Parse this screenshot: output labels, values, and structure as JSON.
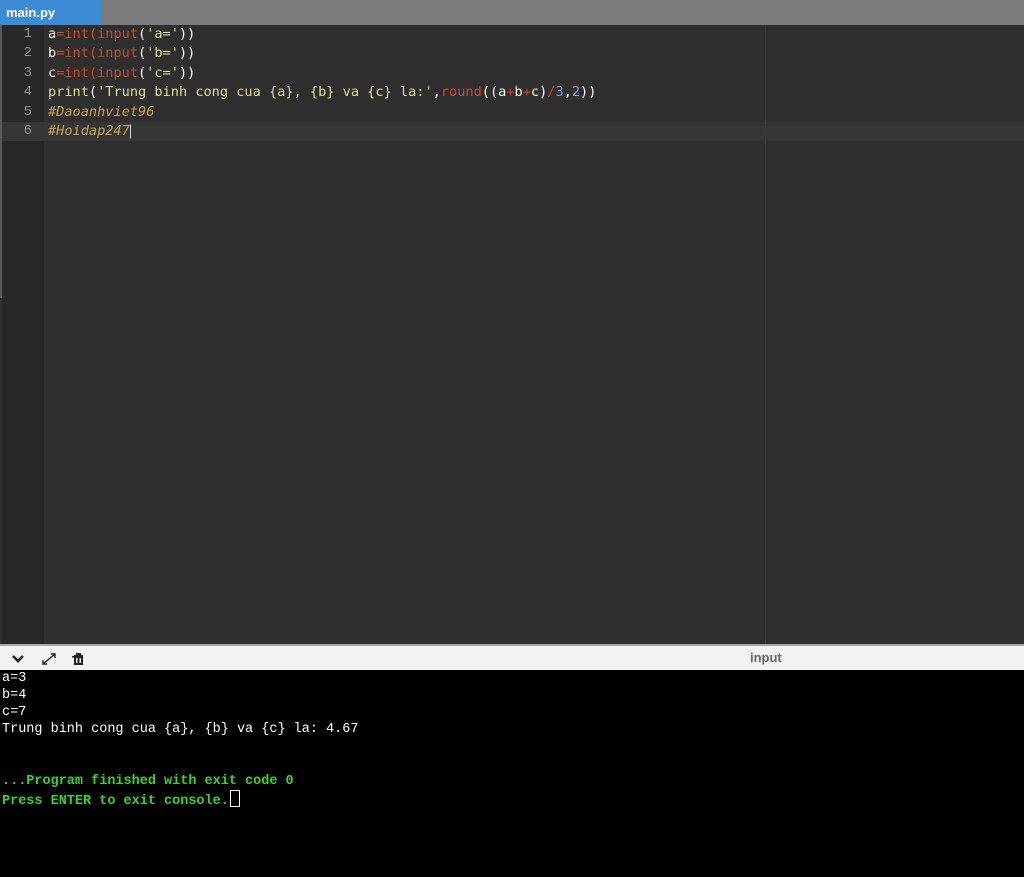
{
  "tab": {
    "title": "main.py"
  },
  "editor": {
    "line_numbers": [
      "1",
      "2",
      "3",
      "4",
      "5",
      "6"
    ],
    "code": {
      "line1": {
        "var": "a",
        "eq": "=",
        "fn": "int",
        "p1": "(",
        "fn2": "input",
        "p2": "(",
        "str": "'a='",
        "close": "))"
      },
      "line2": {
        "var": "b",
        "eq": "=",
        "fn": "int",
        "p1": "(",
        "fn2": "input",
        "p2": "(",
        "str": "'b='",
        "close": "))"
      },
      "line3": {
        "var": "c",
        "eq": "=",
        "fn": "int",
        "p1": "(",
        "fn2": "input",
        "p2": "(",
        "str": "'c='",
        "close": "))"
      },
      "line4": {
        "fn": "print",
        "p1": "(",
        "str": "'Trung binh cong cua {a}, {b} va {c} la:'",
        "comma": ",",
        "fn2": "round",
        "p2": "((",
        "a": "a",
        "plus1": "+",
        "b": "b",
        "plus2": "+",
        "c": "c",
        "p3": ")",
        "div": "/",
        "n3": "3",
        "comma2": ",",
        "n2": "2",
        "close": "))"
      },
      "line5": "#Daoanhviet96",
      "line6": "#Hoidap247"
    }
  },
  "console_header": {
    "collapse_icon": "chevron-down-icon",
    "expand_icon": "expand-arrows-icon",
    "clear_icon": "clear-console-icon",
    "input_label": "input"
  },
  "console": {
    "lines": [
      "a=3",
      "b=4",
      "c=7",
      "Trung binh cong cua {a}, {b} va {c} la: 4.67"
    ],
    "finished": "...Program finished with exit code 0",
    "press_enter": "Press ENTER to exit console."
  }
}
